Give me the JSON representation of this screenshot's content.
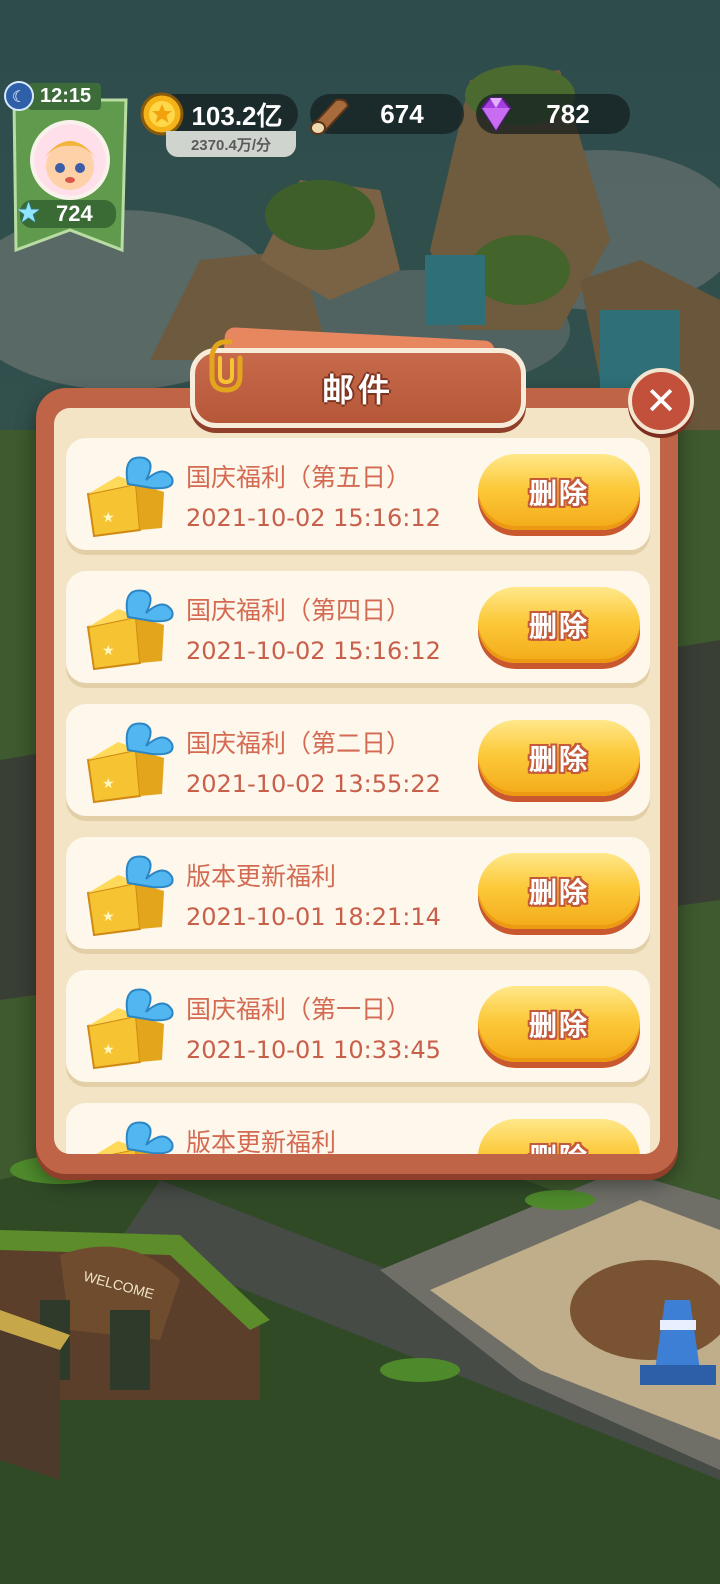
{
  "hud": {
    "time": "12:15",
    "level": "724",
    "coins": "103.2亿",
    "coin_rate": "2370.4万/分",
    "wood": "674",
    "gems": "782",
    "icons": [
      "moon-icon",
      "star-icon",
      "coin-icon",
      "wood-icon",
      "gem-icon"
    ]
  },
  "mail_dialog": {
    "title": "邮件",
    "close_icon": "close-icon",
    "items": [
      {
        "title": "国庆福利（第五日）",
        "date": "2021-10-02 15:16:12",
        "button": "删除"
      },
      {
        "title": "国庆福利（第四日）",
        "date": "2021-10-02 15:16:12",
        "button": "删除"
      },
      {
        "title": "国庆福利（第二日）",
        "date": "2021-10-02 13:55:22",
        "button": "删除"
      },
      {
        "title": "版本更新福利",
        "date": "2021-10-01 18:21:14",
        "button": "删除"
      },
      {
        "title": "国庆福利（第一日）",
        "date": "2021-10-01 10:33:45",
        "button": "删除"
      },
      {
        "title": "版本更新福利",
        "date": "",
        "button": "删除"
      }
    ]
  },
  "world": {
    "sign_text": "WELCOME"
  },
  "colors": {
    "dialog_frame": "#bf6446",
    "dialog_fill": "#f4e4c6",
    "item_text": "#d46a52",
    "button_gold": "#fcc93a"
  }
}
